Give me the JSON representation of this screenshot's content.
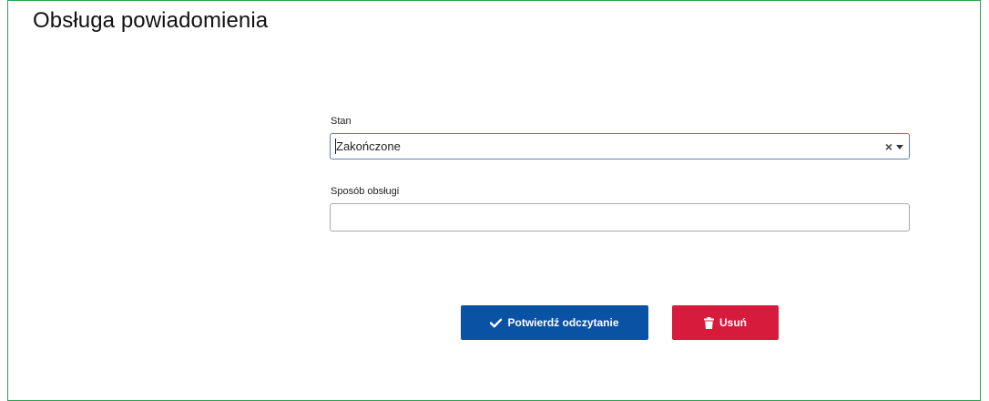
{
  "page": {
    "title": "Obsługa powiadomienia"
  },
  "form": {
    "status": {
      "label": "Stan",
      "value": "Zakończone",
      "clear_symbol": "×"
    },
    "handling_method": {
      "label": "Sposób obsługi",
      "value": "",
      "placeholder": ""
    }
  },
  "actions": {
    "confirm_label": "Potwierdź odczytanie",
    "confirm_icon": "check-icon",
    "delete_label": "Usuń",
    "delete_icon": "trash-icon"
  },
  "colors": {
    "panel_border": "#2aa44f",
    "confirm_button": "#0a52a3",
    "delete_button": "#d61b3c"
  }
}
